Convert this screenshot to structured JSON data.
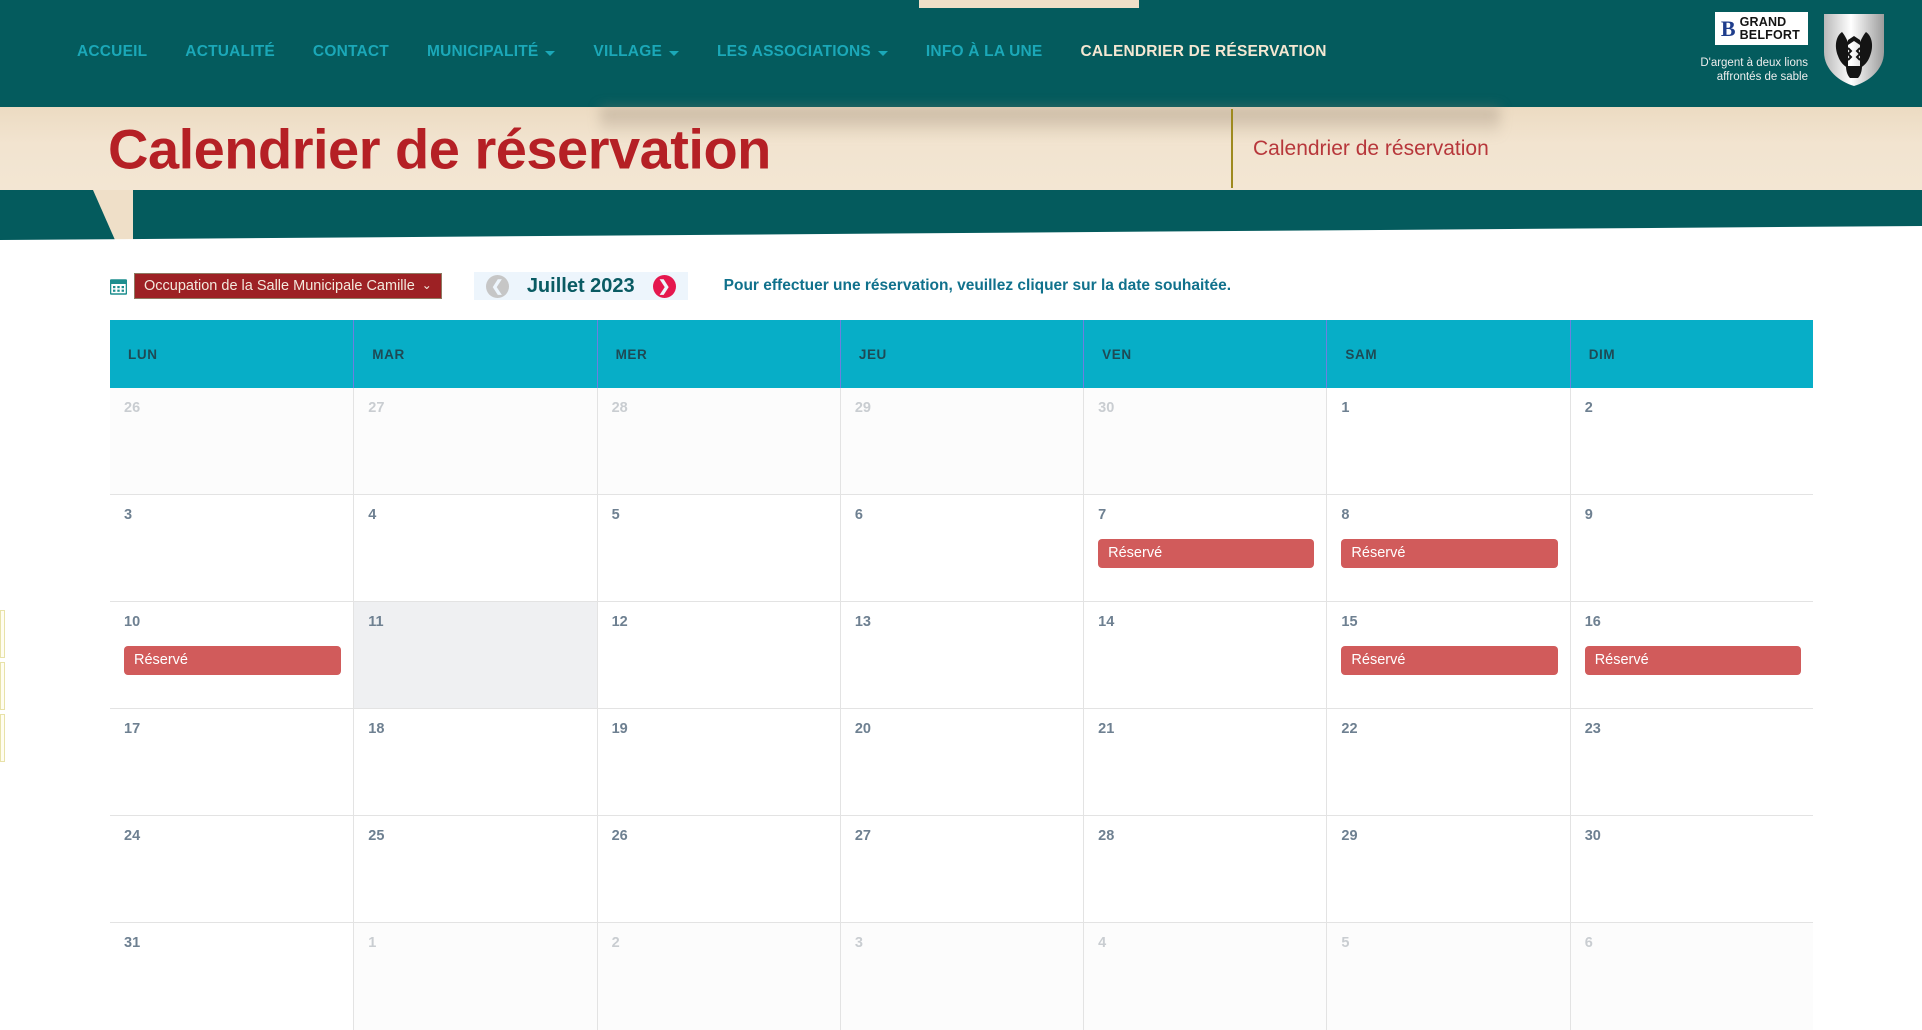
{
  "nav": {
    "items": [
      {
        "label": "ACCUEIL",
        "has_caret": false,
        "active": false
      },
      {
        "label": "ACTUALITÉ",
        "has_caret": false,
        "active": false
      },
      {
        "label": "CONTACT",
        "has_caret": false,
        "active": false
      },
      {
        "label": "MUNICIPALITÉ",
        "has_caret": true,
        "active": false
      },
      {
        "label": "VILLAGE",
        "has_caret": true,
        "active": false
      },
      {
        "label": "LES ASSOCIATIONS",
        "has_caret": true,
        "active": false
      },
      {
        "label": "INFO À LA UNE",
        "has_caret": false,
        "active": false
      },
      {
        "label": "CALENDRIER DE RÉSERVATION",
        "has_caret": false,
        "active": true
      }
    ]
  },
  "logo": {
    "mark": "B",
    "line1": "GRAND",
    "line2": "BELFORT",
    "tagline": "D'argent à deux lions affrontés de sable"
  },
  "banner": {
    "title": "Calendrier de réservation",
    "breadcrumb": "Calendrier de réservation"
  },
  "toolbar": {
    "select_value": "Occupation de la Salle Municipale Camille",
    "select_caret": "⌄",
    "prev_glyph": "❮",
    "next_glyph": "❯",
    "month_label": "Juillet 2023",
    "hint": "Pour effectuer une réservation, veuillez cliquer sur la date souhaitée."
  },
  "calendar": {
    "day_headers": [
      "LUN",
      "MAR",
      "MER",
      "JEU",
      "VEN",
      "SAM",
      "DIM"
    ],
    "event_label": "Réservé",
    "weeks": [
      [
        {
          "day": "26",
          "other": true,
          "event": false,
          "hover": false
        },
        {
          "day": "27",
          "other": true,
          "event": false,
          "hover": false
        },
        {
          "day": "28",
          "other": true,
          "event": false,
          "hover": false
        },
        {
          "day": "29",
          "other": true,
          "event": false,
          "hover": false
        },
        {
          "day": "30",
          "other": true,
          "event": false,
          "hover": false
        },
        {
          "day": "1",
          "other": false,
          "event": false,
          "hover": false
        },
        {
          "day": "2",
          "other": false,
          "event": false,
          "hover": false
        }
      ],
      [
        {
          "day": "3",
          "other": false,
          "event": false,
          "hover": false
        },
        {
          "day": "4",
          "other": false,
          "event": false,
          "hover": false
        },
        {
          "day": "5",
          "other": false,
          "event": false,
          "hover": false
        },
        {
          "day": "6",
          "other": false,
          "event": false,
          "hover": false
        },
        {
          "day": "7",
          "other": false,
          "event": true,
          "hover": false
        },
        {
          "day": "8",
          "other": false,
          "event": true,
          "hover": false
        },
        {
          "day": "9",
          "other": false,
          "event": false,
          "hover": false
        }
      ],
      [
        {
          "day": "10",
          "other": false,
          "event": true,
          "hover": false
        },
        {
          "day": "11",
          "other": false,
          "event": false,
          "hover": true
        },
        {
          "day": "12",
          "other": false,
          "event": false,
          "hover": false
        },
        {
          "day": "13",
          "other": false,
          "event": false,
          "hover": false
        },
        {
          "day": "14",
          "other": false,
          "event": false,
          "hover": false
        },
        {
          "day": "15",
          "other": false,
          "event": true,
          "hover": false
        },
        {
          "day": "16",
          "other": false,
          "event": true,
          "hover": false
        }
      ],
      [
        {
          "day": "17",
          "other": false,
          "event": false,
          "hover": false
        },
        {
          "day": "18",
          "other": false,
          "event": false,
          "hover": false
        },
        {
          "day": "19",
          "other": false,
          "event": false,
          "hover": false
        },
        {
          "day": "20",
          "other": false,
          "event": false,
          "hover": false
        },
        {
          "day": "21",
          "other": false,
          "event": false,
          "hover": false
        },
        {
          "day": "22",
          "other": false,
          "event": false,
          "hover": false
        },
        {
          "day": "23",
          "other": false,
          "event": false,
          "hover": false
        }
      ],
      [
        {
          "day": "24",
          "other": false,
          "event": false,
          "hover": false
        },
        {
          "day": "25",
          "other": false,
          "event": false,
          "hover": false
        },
        {
          "day": "26",
          "other": false,
          "event": false,
          "hover": false
        },
        {
          "day": "27",
          "other": false,
          "event": false,
          "hover": false
        },
        {
          "day": "28",
          "other": false,
          "event": false,
          "hover": false
        },
        {
          "day": "29",
          "other": false,
          "event": false,
          "hover": false
        },
        {
          "day": "30",
          "other": false,
          "event": false,
          "hover": false
        }
      ],
      [
        {
          "day": "31",
          "other": false,
          "event": false,
          "hover": false
        },
        {
          "day": "1",
          "other": true,
          "event": false,
          "hover": false
        },
        {
          "day": "2",
          "other": true,
          "event": false,
          "hover": false
        },
        {
          "day": "3",
          "other": true,
          "event": false,
          "hover": false
        },
        {
          "day": "4",
          "other": true,
          "event": false,
          "hover": false
        },
        {
          "day": "5",
          "other": true,
          "event": false,
          "hover": false
        },
        {
          "day": "6",
          "other": true,
          "event": false,
          "hover": false
        }
      ]
    ]
  },
  "colors": {
    "header_teal": "#045B5D",
    "nav_link": "#1BA8B8",
    "banner_beige": "#EFDFC8",
    "title_red": "#B52025",
    "cal_header_cyan": "#07AEC7",
    "event_red": "#D15B5B",
    "select_red": "#9D2124",
    "next_arrow_pink": "#E5174E"
  }
}
